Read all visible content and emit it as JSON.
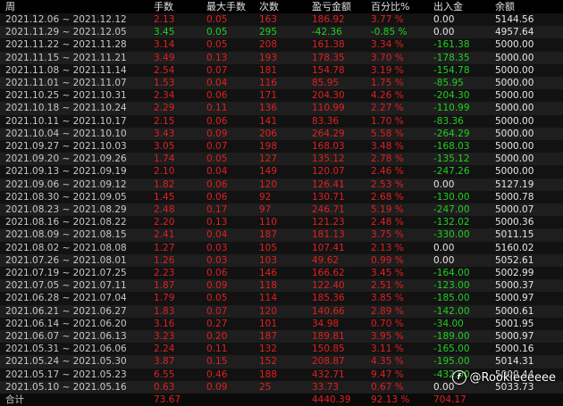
{
  "columns": [
    "周",
    "手数",
    "最大手数",
    "次数",
    "盈亏金额",
    "百分比%",
    "出入金",
    "余额"
  ],
  "rows": [
    {
      "week": "2021.12.06 ~ 2021.12.12",
      "hands": "2.13",
      "max_hands": "0.05",
      "count": "163",
      "pnl": "186.92",
      "pct": "3.77 %",
      "flow": "0.00",
      "balance": "5144.56",
      "dir": "up"
    },
    {
      "week": "2021.11.29 ~ 2021.12.05",
      "hands": "3.45",
      "max_hands": "0.05",
      "count": "295",
      "pnl": "-42.36",
      "pct": "-0.85 %",
      "flow": "0.00",
      "balance": "4957.64",
      "dir": "down"
    },
    {
      "week": "2021.11.22 ~ 2021.11.28",
      "hands": "3.14",
      "max_hands": "0.05",
      "count": "208",
      "pnl": "161.38",
      "pct": "3.34 %",
      "flow": "-161.38",
      "balance": "5000.00",
      "dir": "up"
    },
    {
      "week": "2021.11.15 ~ 2021.11.21",
      "hands": "3.49",
      "max_hands": "0.13",
      "count": "193",
      "pnl": "178.35",
      "pct": "3.70 %",
      "flow": "-178.35",
      "balance": "5000.00",
      "dir": "up"
    },
    {
      "week": "2021.11.08 ~ 2021.11.14",
      "hands": "2.54",
      "max_hands": "0.07",
      "count": "181",
      "pnl": "154.78",
      "pct": "3.19 %",
      "flow": "-154.78",
      "balance": "5000.00",
      "dir": "up"
    },
    {
      "week": "2021.11.01 ~ 2021.11.07",
      "hands": "1.53",
      "max_hands": "0.04",
      "count": "116",
      "pnl": "85.95",
      "pct": "1.75 %",
      "flow": "-85.95",
      "balance": "5000.00",
      "dir": "up"
    },
    {
      "week": "2021.10.25 ~ 2021.10.31",
      "hands": "2.34",
      "max_hands": "0.06",
      "count": "171",
      "pnl": "204.30",
      "pct": "4.26 %",
      "flow": "-204.30",
      "balance": "5000.00",
      "dir": "up"
    },
    {
      "week": "2021.10.18 ~ 2021.10.24",
      "hands": "2.29",
      "max_hands": "0.11",
      "count": "136",
      "pnl": "110.99",
      "pct": "2.27 %",
      "flow": "-110.99",
      "balance": "5000.00",
      "dir": "up"
    },
    {
      "week": "2021.10.11 ~ 2021.10.17",
      "hands": "2.15",
      "max_hands": "0.06",
      "count": "141",
      "pnl": "83.36",
      "pct": "1.70 %",
      "flow": "-83.36",
      "balance": "5000.00",
      "dir": "up"
    },
    {
      "week": "2021.10.04 ~ 2021.10.10",
      "hands": "3.43",
      "max_hands": "0.09",
      "count": "206",
      "pnl": "264.29",
      "pct": "5.58 %",
      "flow": "-264.29",
      "balance": "5000.00",
      "dir": "up"
    },
    {
      "week": "2021.09.27 ~ 2021.10.03",
      "hands": "3.05",
      "max_hands": "0.07",
      "count": "198",
      "pnl": "168.03",
      "pct": "3.48 %",
      "flow": "-168.03",
      "balance": "5000.00",
      "dir": "up"
    },
    {
      "week": "2021.09.20 ~ 2021.09.26",
      "hands": "1.74",
      "max_hands": "0.05",
      "count": "127",
      "pnl": "135.12",
      "pct": "2.78 %",
      "flow": "-135.12",
      "balance": "5000.00",
      "dir": "up"
    },
    {
      "week": "2021.09.13 ~ 2021.09.19",
      "hands": "2.10",
      "max_hands": "0.04",
      "count": "149",
      "pnl": "120.07",
      "pct": "2.46 %",
      "flow": "-247.26",
      "balance": "5000.00",
      "dir": "up"
    },
    {
      "week": "2021.09.06 ~ 2021.09.12",
      "hands": "1.82",
      "max_hands": "0.06",
      "count": "120",
      "pnl": "126.41",
      "pct": "2.53 %",
      "flow": "0.00",
      "balance": "5127.19",
      "dir": "up"
    },
    {
      "week": "2021.08.30 ~ 2021.09.05",
      "hands": "1.45",
      "max_hands": "0.06",
      "count": "92",
      "pnl": "130.71",
      "pct": "2.68 %",
      "flow": "-130.00",
      "balance": "5000.78",
      "dir": "up"
    },
    {
      "week": "2021.08.23 ~ 2021.08.29",
      "hands": "2.48",
      "max_hands": "0.17",
      "count": "97",
      "pnl": "246.71",
      "pct": "5.19 %",
      "flow": "-247.00",
      "balance": "5000.07",
      "dir": "up"
    },
    {
      "week": "2021.08.16 ~ 2021.08.22",
      "hands": "2.20",
      "max_hands": "0.13",
      "count": "110",
      "pnl": "121.23",
      "pct": "2.48 %",
      "flow": "-132.02",
      "balance": "5000.36",
      "dir": "up"
    },
    {
      "week": "2021.08.09 ~ 2021.08.15",
      "hands": "2.41",
      "max_hands": "0.04",
      "count": "187",
      "pnl": "181.13",
      "pct": "3.75 %",
      "flow": "-330.00",
      "balance": "5011.15",
      "dir": "up"
    },
    {
      "week": "2021.08.02 ~ 2021.08.08",
      "hands": "1.27",
      "max_hands": "0.03",
      "count": "105",
      "pnl": "107.41",
      "pct": "2.13 %",
      "flow": "0.00",
      "balance": "5160.02",
      "dir": "up"
    },
    {
      "week": "2021.07.26 ~ 2021.08.01",
      "hands": "1.26",
      "max_hands": "0.03",
      "count": "103",
      "pnl": "49.62",
      "pct": "0.99 %",
      "flow": "0.00",
      "balance": "5052.61",
      "dir": "up"
    },
    {
      "week": "2021.07.19 ~ 2021.07.25",
      "hands": "2.23",
      "max_hands": "0.06",
      "count": "146",
      "pnl": "166.62",
      "pct": "3.45 %",
      "flow": "-164.00",
      "balance": "5002.99",
      "dir": "up"
    },
    {
      "week": "2021.07.05 ~ 2021.07.11",
      "hands": "1.87",
      "max_hands": "0.09",
      "count": "118",
      "pnl": "122.40",
      "pct": "2.51 %",
      "flow": "-123.00",
      "balance": "5000.37",
      "dir": "up"
    },
    {
      "week": "2021.06.28 ~ 2021.07.04",
      "hands": "1.79",
      "max_hands": "0.05",
      "count": "114",
      "pnl": "185.36",
      "pct": "3.85 %",
      "flow": "-185.00",
      "balance": "5000.97",
      "dir": "up"
    },
    {
      "week": "2021.06.21 ~ 2021.06.27",
      "hands": "1.83",
      "max_hands": "0.07",
      "count": "120",
      "pnl": "140.66",
      "pct": "2.89 %",
      "flow": "-142.00",
      "balance": "5000.61",
      "dir": "up"
    },
    {
      "week": "2021.06.14 ~ 2021.06.20",
      "hands": "3.16",
      "max_hands": "0.27",
      "count": "101",
      "pnl": "34.98",
      "pct": "0.70 %",
      "flow": "-34.00",
      "balance": "5001.95",
      "dir": "up"
    },
    {
      "week": "2021.06.07 ~ 2021.06.13",
      "hands": "3.23",
      "max_hands": "0.20",
      "count": "187",
      "pnl": "189.81",
      "pct": "3.95 %",
      "flow": "-189.00",
      "balance": "5000.97",
      "dir": "up"
    },
    {
      "week": "2021.05.31 ~ 2021.06.06",
      "hands": "2.24",
      "max_hands": "0.11",
      "count": "132",
      "pnl": "150.85",
      "pct": "3.11 %",
      "flow": "-165.00",
      "balance": "5000.16",
      "dir": "up"
    },
    {
      "week": "2021.05.24 ~ 2021.05.30",
      "hands": "3.87",
      "max_hands": "0.15",
      "count": "152",
      "pnl": "208.87",
      "pct": "4.35 %",
      "flow": "-195.00",
      "balance": "5014.31",
      "dir": "up"
    },
    {
      "week": "2021.05.17 ~ 2021.05.23",
      "hands": "6.55",
      "max_hands": "0.46",
      "count": "188",
      "pnl": "432.71",
      "pct": "9.47 %",
      "flow": "-432.00",
      "balance": "5000.44",
      "dir": "up"
    },
    {
      "week": "2021.05.10 ~ 2021.05.16",
      "hands": "0.63",
      "max_hands": "0.09",
      "count": "25",
      "pnl": "33.73",
      "pct": "0.67 %",
      "flow": "0.00",
      "balance": "5033.73",
      "dir": "up"
    }
  ],
  "total": {
    "label": "合计",
    "hands": "73.67",
    "pnl": "4440.39",
    "pct": "92.13 %",
    "flow": "704.17"
  },
  "watermark": {
    "text": "@Rookieeeeee"
  },
  "colors": {
    "positive": "#e02020",
    "negative": "#20d020",
    "background": "#000000"
  }
}
